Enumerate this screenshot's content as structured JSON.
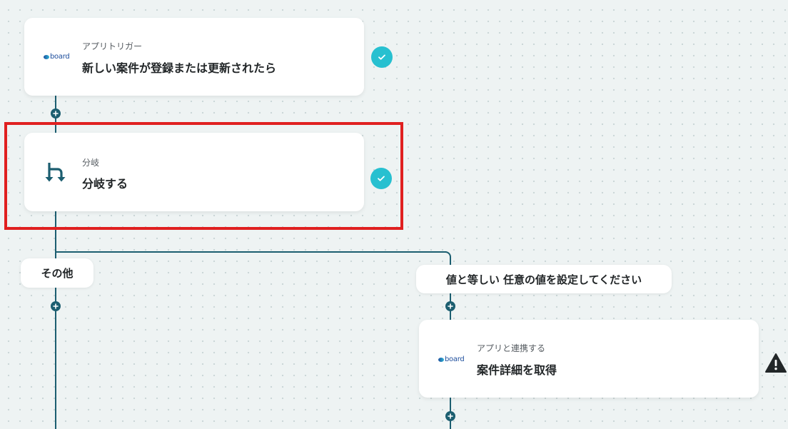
{
  "nodes": {
    "trigger": {
      "logo_text": "board",
      "subtitle": "アプリトリガー",
      "title": "新しい案件が登録または更新されたら"
    },
    "branch": {
      "subtitle": "分岐",
      "title": "分岐する"
    },
    "app_action": {
      "logo_text": "board",
      "subtitle": "アプリと連携する",
      "title": "案件詳細を取得"
    }
  },
  "branch_labels": {
    "other": "その他",
    "equals": "値と等しい 任意の値を設定してください"
  },
  "colors": {
    "connector": "#1c5e70",
    "check": "#27c0d0",
    "highlight": "#e02020",
    "warning": "#222628"
  },
  "icons": {
    "branch": "branch-icon",
    "check": "check-icon",
    "warning": "warning-icon",
    "add": "plus-icon"
  }
}
